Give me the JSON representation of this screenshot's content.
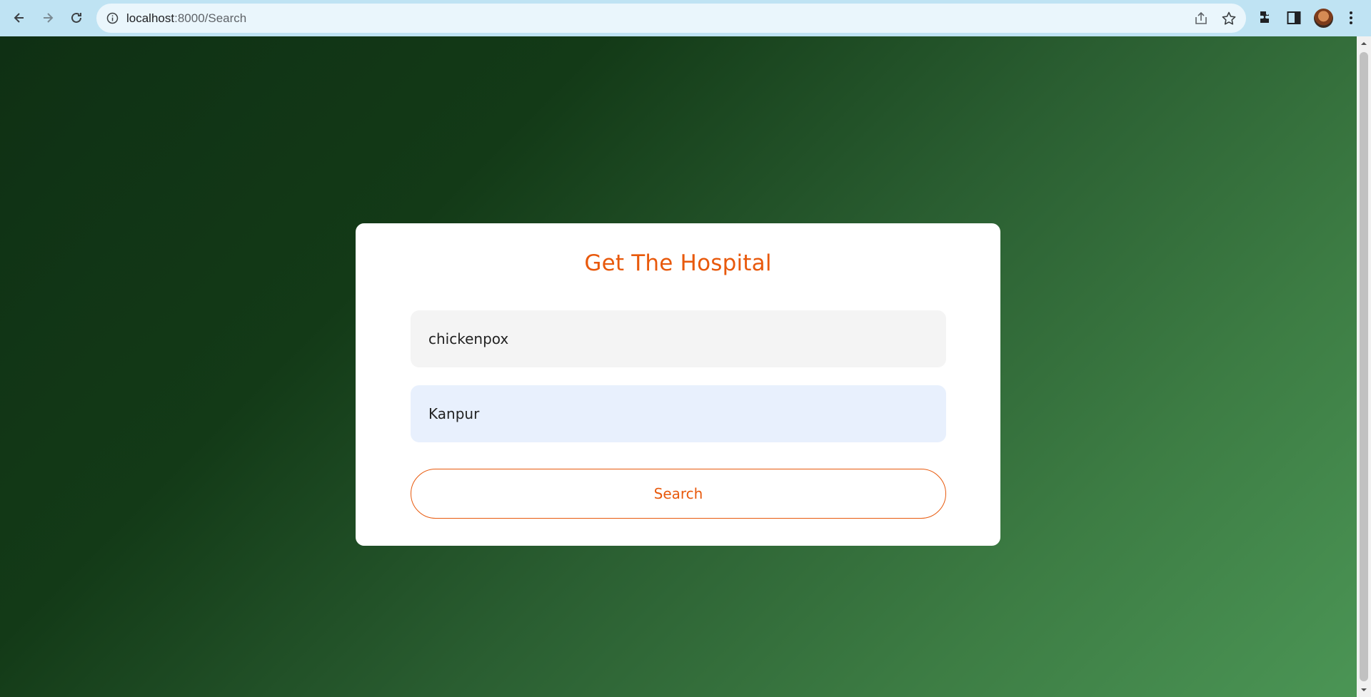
{
  "browser": {
    "url_host": "localhost",
    "url_rest": ":8000/Search"
  },
  "form": {
    "title": "Get The Hospital",
    "disease_value": "chickenpox",
    "city_value": "Kanpur",
    "search_label": "Search"
  },
  "colors": {
    "accent": "#e8590c",
    "background_dark": "#0f3014",
    "background_light": "#4b9555"
  },
  "icons": [
    "back-arrow-icon",
    "forward-arrow-icon",
    "reload-icon",
    "info-icon",
    "share-icon",
    "star-icon",
    "extensions-icon",
    "side-panel-icon",
    "avatar",
    "kebab-menu-icon"
  ]
}
